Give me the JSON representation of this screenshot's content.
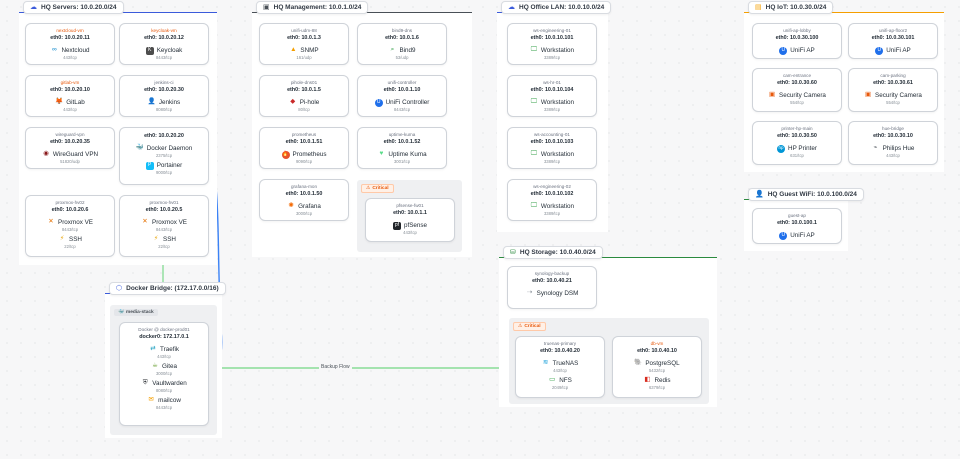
{
  "groups": {
    "servers": {
      "label": "HQ Servers: 10.0.20.0/24",
      "color": "#3b5bdb",
      "icon": "cloud-icon"
    },
    "mgmt": {
      "label": "HQ Management: 10.0.1.0/24",
      "color": "#495057",
      "icon": "server-icon"
    },
    "lan": {
      "label": "HQ Office LAN: 10.0.10.0/24",
      "color": "#3b5bdb",
      "icon": "cloud-icon"
    },
    "iot": {
      "label": "HQ IoT: 10.0.30.0/24",
      "color": "#f59f00",
      "icon": "lock-icon"
    },
    "guest": {
      "label": "HQ Guest WiFi: 10.0.100.0/24",
      "color": "#2b8a3e",
      "icon": "user-icon"
    },
    "storage": {
      "label": "HQ Storage: 10.0.40.0/24",
      "color": "#2b8a3e",
      "icon": "database-icon"
    },
    "docker": {
      "label": "Docker Bridge: (172.17.0.0/16)",
      "color": "#3b5bdb",
      "icon": "cube-icon"
    }
  },
  "subgroups": {
    "mgmt_critical": "Critical",
    "storage_critical": "Critical",
    "media_stack": "media-stack"
  },
  "nodes": {
    "nextcloud": {
      "host": "nextcloud-vm",
      "ip": "eth0: 10.0.20.11",
      "services": [
        {
          "name": "Nextcloud",
          "port": "443/tcp"
        }
      ]
    },
    "keycloak": {
      "host": "keycloak-vm",
      "ip": "eth0: 10.0.20.12",
      "services": [
        {
          "name": "Keycloak",
          "port": "8443/tcp"
        }
      ]
    },
    "gitlab": {
      "host": "gitlab-vm",
      "ip": "eth0: 10.0.20.10",
      "services": [
        {
          "name": "GitLab",
          "port": "443/tcp"
        }
      ]
    },
    "jenkins": {
      "host": "jenkins-ci",
      "ip": "eth0: 10.0.20.30",
      "services": [
        {
          "name": "Jenkins",
          "port": "8080/tcp"
        }
      ]
    },
    "wireguard": {
      "host": "wireguard-vpn",
      "ip": "eth0: 10.0.20.35",
      "services": [
        {
          "name": "WireGuard VPN",
          "port": "51820/udp"
        }
      ]
    },
    "docker_host": {
      "host": "",
      "ip": "eth0: 10.0.20.20",
      "services": [
        {
          "name": "Docker Daemon",
          "port": "2375/tcp"
        },
        {
          "name": "Portainer",
          "port": "9000/tcp"
        }
      ]
    },
    "proxmox2": {
      "host": "proxmox-hv02",
      "ip": "eth0: 10.0.20.6",
      "services": [
        {
          "name": "Proxmox VE",
          "port": "8443/tcp"
        },
        {
          "name": "SSH",
          "port": "22/tcp"
        }
      ]
    },
    "proxmox1": {
      "host": "proxmox-hv01",
      "ip": "eth0: 10.0.20.5",
      "services": [
        {
          "name": "Proxmox VE",
          "port": "8443/tcp"
        },
        {
          "name": "SSH",
          "port": "22/tcp"
        }
      ]
    },
    "snmp": {
      "host": "unifi-udm-88",
      "ip": "eth0: 10.0.1.3",
      "services": [
        {
          "name": "SNMP",
          "port": "161/udp"
        }
      ]
    },
    "bind9": {
      "host": "bind9-dns",
      "ip": "eth0: 10.0.1.6",
      "services": [
        {
          "name": "Bind9",
          "port": "53/udp"
        }
      ]
    },
    "pihole": {
      "host": "pihole-dns01",
      "ip": "eth0: 10.0.1.5",
      "services": [
        {
          "name": "Pi-hole",
          "port": "80/tcp"
        }
      ]
    },
    "unifi_ctrl": {
      "host": "unifi-controller",
      "ip": "eth0: 10.0.1.10",
      "services": [
        {
          "name": "UniFi Controller",
          "port": "8443/tcp"
        }
      ]
    },
    "prometheus": {
      "host": "prometheus",
      "ip": "eth0: 10.0.1.51",
      "services": [
        {
          "name": "Prometheus",
          "port": "9090/tcp"
        }
      ]
    },
    "uptime": {
      "host": "uptime-kuma",
      "ip": "eth0: 10.0.1.52",
      "services": [
        {
          "name": "Uptime Kuma",
          "port": "3001/tcp"
        }
      ]
    },
    "grafana": {
      "host": "grafana-mon",
      "ip": "eth0: 10.0.1.50",
      "services": [
        {
          "name": "Grafana",
          "port": "3000/tcp"
        }
      ]
    },
    "pfsense": {
      "host": "pfsense-fw01",
      "ip": "eth0: 10.0.1.1",
      "services": [
        {
          "name": "pfSense",
          "port": "443/tcp"
        }
      ]
    },
    "ws1": {
      "host": "ws-engineering-01",
      "ip": "eth0: 10.0.10.101",
      "services": [
        {
          "name": "Workstation",
          "port": "3389/tcp"
        }
      ]
    },
    "ws2": {
      "host": "ws-hr-01",
      "ip": "eth0: 10.0.10.104",
      "services": [
        {
          "name": "Workstation",
          "port": "3389/tcp"
        }
      ]
    },
    "ws3": {
      "host": "ws-accounting-01",
      "ip": "eth0: 10.0.10.103",
      "services": [
        {
          "name": "Workstation",
          "port": "3389/tcp"
        }
      ]
    },
    "ws4": {
      "host": "ws-engineering-02",
      "ip": "eth0: 10.0.10.102",
      "services": [
        {
          "name": "Workstation",
          "port": "3389/tcp"
        }
      ]
    },
    "ap_lobby": {
      "host": "unifi-ap-lobby",
      "ip": "eth0: 10.0.30.100",
      "services": [
        {
          "name": "UniFi AP",
          "port": ""
        }
      ]
    },
    "ap_floor2": {
      "host": "unifi-ap-floor2",
      "ip": "eth0: 10.0.30.101",
      "services": [
        {
          "name": "UniFi AP",
          "port": ""
        }
      ]
    },
    "cam_entrance": {
      "host": "cam-entrance",
      "ip": "eth0: 10.0.30.60",
      "services": [
        {
          "name": "Security Camera",
          "port": "554/tcp"
        }
      ]
    },
    "cam_parking": {
      "host": "cam-parking",
      "ip": "eth0: 10.0.30.61",
      "services": [
        {
          "name": "Security Camera",
          "port": "554/tcp"
        }
      ]
    },
    "printer": {
      "host": "printer-hp-main",
      "ip": "eth0: 10.0.30.50",
      "services": [
        {
          "name": "HP Printer",
          "port": "631/tcp"
        }
      ]
    },
    "hue": {
      "host": "hue-bridge",
      "ip": "eth0: 10.0.30.10",
      "services": [
        {
          "name": "Philips Hue",
          "port": "443/tcp"
        }
      ]
    },
    "guest_ap": {
      "host": "guest-ap",
      "ip": "eth0: 10.0.100.1",
      "services": [
        {
          "name": "UniFi AP",
          "port": ""
        }
      ]
    },
    "synology": {
      "host": "synology-backup",
      "ip": "eth0: 10.0.40.21",
      "services": [
        {
          "name": "Synology DSM",
          "port": ""
        }
      ]
    },
    "truenas": {
      "host": "truenas-primary",
      "ip": "eth0: 10.0.40.20",
      "services": [
        {
          "name": "TrueNAS",
          "port": "443/tcp"
        },
        {
          "name": "NFS",
          "port": "2049/tcp"
        }
      ]
    },
    "db": {
      "host": "db-vm",
      "ip": "eth0: 10.0.40.10",
      "services": [
        {
          "name": "PostgreSQL",
          "port": "5432/tcp"
        },
        {
          "name": "Redis",
          "port": "6379/tcp"
        }
      ]
    },
    "docker_prod": {
      "host": "Docker @ docker-prod01",
      "ip": "docker0: 172.17.0.1",
      "services": [
        {
          "name": "Traefik",
          "port": "443/tcp"
        },
        {
          "name": "Gitea",
          "port": "3000/tcp"
        },
        {
          "name": "Vaultwarden",
          "port": "8080/tcp"
        },
        {
          "name": "mailcow",
          "port": "8443/tcp"
        }
      ]
    }
  },
  "edges": {
    "backup_flow": "Backup Flow"
  }
}
